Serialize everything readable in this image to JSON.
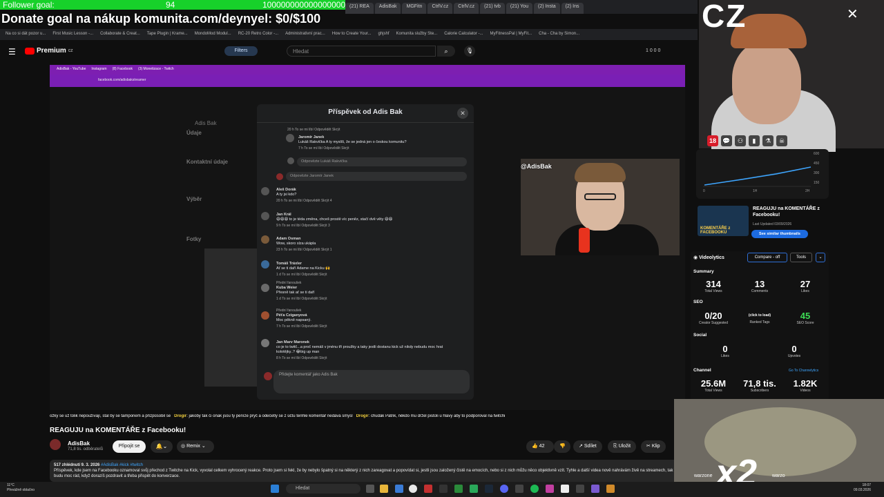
{
  "overlay": {
    "follower_label": "Follower goal:",
    "follower_count": "94",
    "follower_target": "100000000000000000",
    "donate": "Donate goal na nákup komunita.com/deynyel: $0/$100",
    "cz": "CZ"
  },
  "browser": {
    "tabs": [
      "(21) REA",
      "AdisBak",
      "MGFitn",
      "CtrlV.cz",
      "CtrlV.cz",
      "(21) tvb",
      "(21) You",
      "(2) Insta",
      "(2) Ins"
    ],
    "bookmarks": [
      "Na co si dát pozor u...",
      "First Music Lesson -...",
      "Collaborate & Creat...",
      "Tape Plugin | Krame...",
      "MondoMod Modul...",
      "RC-20 Retro Color -...",
      "Administrativní prac...",
      "How to Create Your...",
      "ghjshf",
      "Komunita služby Ste...",
      "Calorie Calculator -...",
      "MyFitnessPal | MyFit...",
      "Cha - Cha by Simon..."
    ]
  },
  "youtube": {
    "logo": "Premium",
    "logo_sup": "CZ",
    "filters": "Filters",
    "search_placeholder": "Hledat",
    "header_counts": "1 0 0 0",
    "video_title": "REAGUJU na KOMENTÁŘE z Facebooku!",
    "channel_name": "AdisBak",
    "channel_subs": "71,8 tis. odběratelů",
    "join": "Připojit se",
    "remix": "Remix",
    "like_count": "42",
    "share": "Sdílet",
    "save": "Uložit",
    "clip": "Klip",
    "desc_views": "517 zhlédnutí  9. 3. 2026",
    "desc_tags": "#AdisBak #kick #twitch",
    "desc_text": "Příspěvek, kde jsem na Facebooku oznamoval svůj přechod z Twitche na Kick, vyvolal celkem vyhrocený reakce. Proto jsem si řekl, že by nebylo špatný si na některý z nich zareagovat a popovídat si, jestli jsou založený čistě na emocích, nebo si z nich můžu něco objektivně vzít. Tyhle a další videa nově nahrávám živě na streamech, tak budu moc rád, když dorazíš pozdravit a třeba přispět do konverzace."
  },
  "inner_browser": {
    "tabs": [
      "AdisBak - YouTube",
      "Instagram",
      "(8) Facebook",
      "(3) Monetizace - Twitch"
    ],
    "url": "facebook.com/adisbakstreamer"
  },
  "facebook_modal": {
    "title": "Příspěvek od Adis Bak",
    "comments": [
      {
        "name": "",
        "text": "",
        "meta": "20 h   To se mi líbí   Odpovědět   Skrýt"
      },
      {
        "name": "Jaromír Janek",
        "text": "Lukáš Rakvička A ty myslíš, že se jedná jen o českou komunitu?",
        "meta": "7 h   To se mi líbí   Odpovědět   Skrýt"
      },
      {
        "name": "Aleš Dorák",
        "text": "A ty jsi kdo?",
        "meta": "20 h   To se mi líbí   Odpovědět   Skrýt   4"
      },
      {
        "name": "Jan Král",
        "text": "😄😄😄 to je téda změna, chceš prostě víc peněz, stačí dvě věty 😄😄",
        "meta": "9 h   To se mi líbí   Odpovědět   Skrýt   3"
      },
      {
        "name": "Adam Osman",
        "text": "Wow, skoro slza ukápla",
        "meta": "23 h   To se mi líbí   Odpovědět   Skrýt   1"
      },
      {
        "name": "Tomáš Tráxler",
        "text": "Ať se ti daří Adame na Kicku 🙌",
        "meta": "1 d   To se mi líbí   Odpovědět   Skrýt"
      },
      {
        "name": "Kuba Weier",
        "text": "Přesně tak ať se ti daří",
        "meta": "1 d   To se mi líbí   Odpovědět   Skrýt"
      },
      {
        "name": "Péťa Cziganyová",
        "text": "Moc pěkně napsaný.",
        "meta": "7 h   To se mi líbí   Odpovědět   Skrýt"
      },
      {
        "name": "Jan Marv Maronek",
        "text": "co je to twitč...a proč nemáš v jménu tři proužky a taky jestli dostanu kick už nikdy nebudu moc hrat kolotějky..? 😂big up man",
        "meta": "8 h   To se mi líbí   Odpovědět   Skrýt"
      }
    ],
    "reply_lukas": "Odpovězte Lukáš Rakvička",
    "reply_jaromir": "Odpovězte Jaromír Janek",
    "comment_placeholder": "Přidejte komentář jako Adis Bak",
    "top_author_label": "Přední fanoušek"
  },
  "fb_side": {
    "name": "Adis Bak",
    "udaje": "Údaje",
    "kontakt": "Kontaktní údaje",
    "vyber": "Výběr",
    "fotky": "Fotky"
  },
  "camtag": "@AdisBak",
  "ticker": {
    "text1": "ožky se už tolik nepoužívají, stal by se tamponem a přizpůsobil se",
    "user1": "Drogir",
    "text2": "jakoby tak či onak jsou ty peníze pryč a odečetly se z účtu tenhle komentář nedává smysl",
    "user2": "Drogir",
    "text3": "chudák Patrik, někdo mu držel pistoli u hlavy aby to podporoval na twitchi"
  },
  "analytics": {
    "ticks": [
      "600",
      "450",
      "300",
      "150"
    ],
    "xlabels": [
      "0",
      "1H",
      "2H"
    ]
  },
  "thumb": {
    "title": "REAGUJU na KOMENTÁŘE z Facebooku!",
    "updated": "Last Updated 03/09/2026",
    "similar": "See similar thumbnails",
    "img_text": "KOMENTÁŘE z FACEBOOKU"
  },
  "videolytics": {
    "title": "Videolytics",
    "compare": "Compare - off",
    "tools": "Tools",
    "summary": "Summary",
    "total_views": "314",
    "total_views_l": "Total Views",
    "comments": "13",
    "comments_l": "Comments",
    "likes": "27",
    "likes_l": "Likes",
    "seo": "SEO",
    "creator": "0/20",
    "creator_l": "Creator Suggested",
    "ranked": "(click to load)",
    "ranked_l": "Ranked Tags",
    "seo_score": "45",
    "seo_score_l": "SEO Score",
    "social": "Social",
    "s_likes": "0",
    "s_likes_l": "Likes",
    "upvotes": "0",
    "upvotes_l": "Upvotes",
    "channel": "Channel",
    "go_channel": "Go To Channelytics",
    "ch_views": "25.6M",
    "ch_views_l": "Total Views",
    "ch_subs": "71,8 tis.",
    "ch_subs_l": "Subscribers",
    "ch_videos": "1.82K",
    "ch_videos_l": "Videos"
  },
  "green_labels": [
    "warzone",
    "warzo"
  ],
  "x2": "x2",
  "taskbar": {
    "weather_temp": "11°C",
    "weather_desc": "Převážně oblačno",
    "search": "Hledat",
    "time": "18:07",
    "date": "09.03.2026"
  },
  "colors": {
    "accent_purple": "#7d1fb1",
    "follower_green": "#17d12a",
    "yt_red": "#ff0000",
    "seo_green": "#3ddc54",
    "link_blue": "#3ea6ff"
  }
}
